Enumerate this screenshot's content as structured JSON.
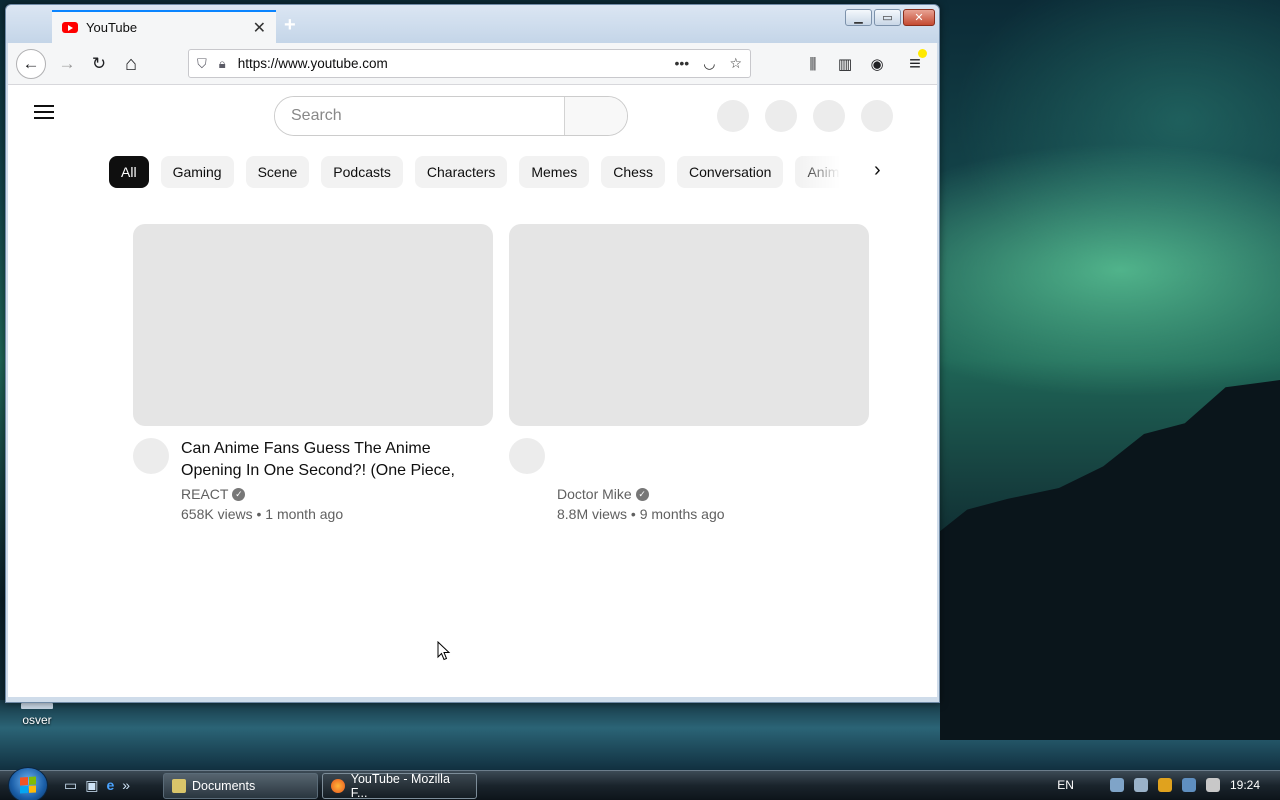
{
  "desktop": {
    "icon_label": "osver"
  },
  "browser": {
    "tab": {
      "title": "YouTube",
      "close_glyph": "✕",
      "new_tab_glyph": "+"
    },
    "window_buttons": {
      "minimize": "▁",
      "maximize": "▭",
      "close": "✕"
    },
    "nav": {
      "back_glyph": "←",
      "forward_glyph": "→",
      "reload_glyph": "↻",
      "home_glyph": "⌂",
      "url": "https://www.youtube.com",
      "page_actions_glyph": "•••",
      "pocket_glyph": "◡",
      "bookmark_glyph": "☆",
      "library_glyph": "⫼",
      "sidebar_glyph": "▥",
      "account_glyph": "◉",
      "menu_glyph": "≡"
    }
  },
  "youtube": {
    "search": {
      "placeholder": "Search"
    },
    "chips": [
      "All",
      "Gaming",
      "Scene",
      "Podcasts",
      "Characters",
      "Memes",
      "Chess",
      "Conversation",
      "Anime"
    ],
    "chip_arrow_glyph": "›",
    "videos": [
      {
        "title": "Can Anime Fans Guess The Anime Opening In One Second?! (One Piece,",
        "channel": "REACT",
        "verified_glyph": "✓",
        "stats": "658K views • 1 month ago"
      },
      {
        "title": "",
        "channel": "Doctor Mike",
        "verified_glyph": "✓",
        "stats": "8.8M views • 9 months ago"
      }
    ]
  },
  "taskbar": {
    "quick_launch_more": "»",
    "buttons": [
      {
        "label": "Documents"
      },
      {
        "label": "YouTube - Mozilla F..."
      }
    ],
    "language": "EN",
    "clock": "19:24"
  },
  "colors": {
    "youtube_red": "#ff0000",
    "chip_active": "#0f0f0f",
    "tab_accent": "#0a84ff"
  }
}
